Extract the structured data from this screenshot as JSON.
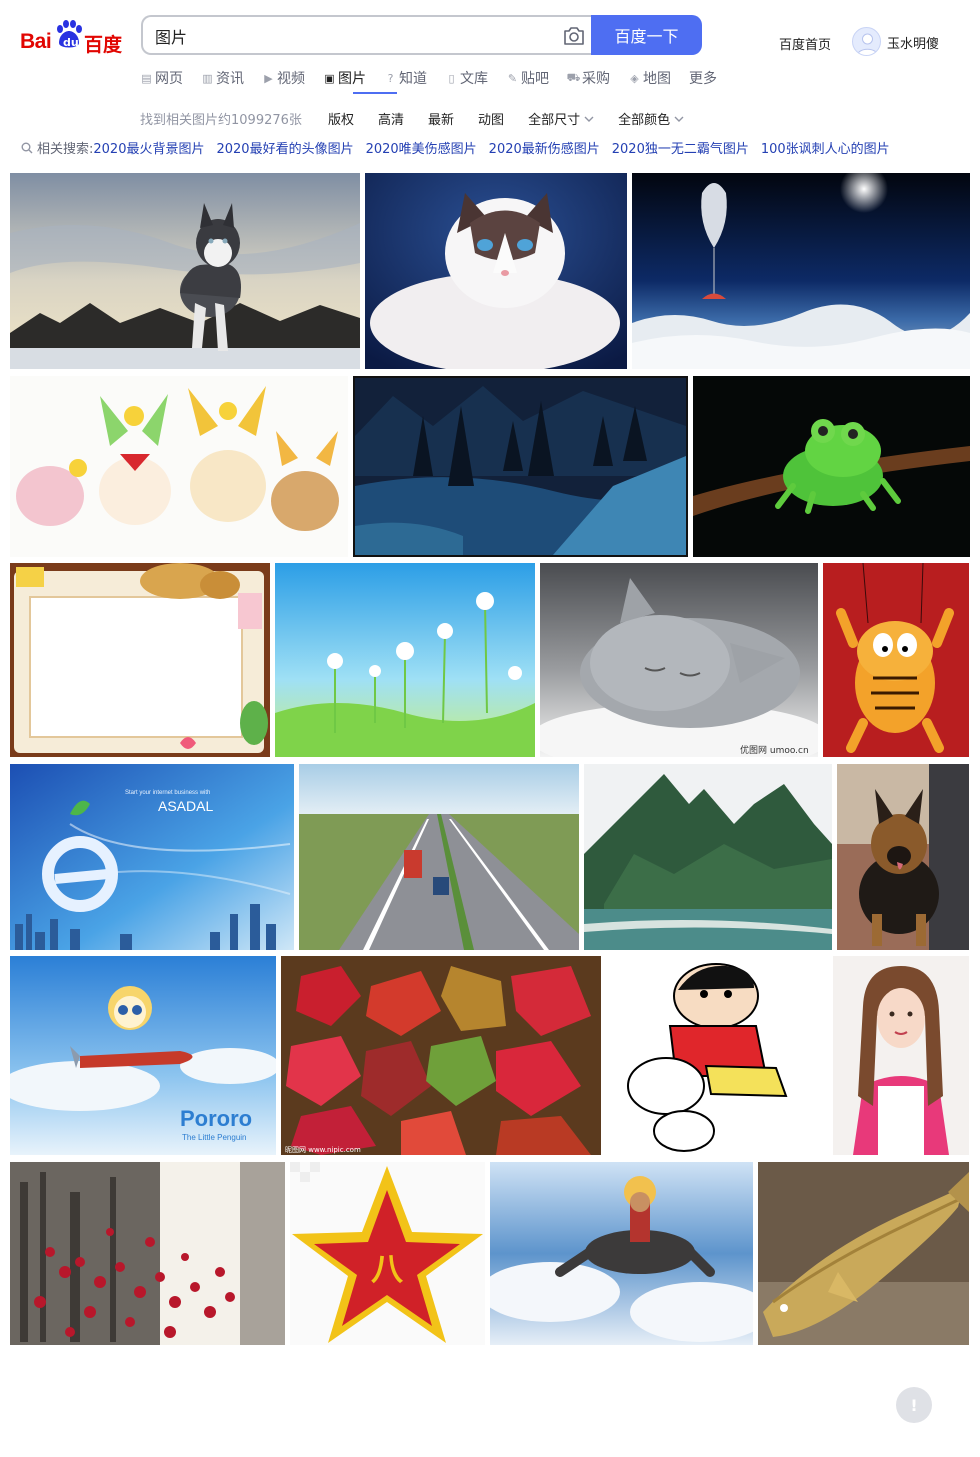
{
  "header": {
    "logo_latin": "Bai",
    "logo_du": "du",
    "logo_chinese": "百度",
    "search_value": "图片",
    "search_button": "百度一下",
    "home_link": "百度首页",
    "username": "玉水明傻"
  },
  "nav": {
    "items": [
      {
        "label": "网页",
        "icon": "web-icon"
      },
      {
        "label": "资讯",
        "icon": "news-icon"
      },
      {
        "label": "视频",
        "icon": "video-icon"
      },
      {
        "label": "图片",
        "icon": "image-icon",
        "active": true
      },
      {
        "label": "知道",
        "icon": "question-icon"
      },
      {
        "label": "文库",
        "icon": "doc-icon"
      },
      {
        "label": "贴吧",
        "icon": "tieba-icon"
      },
      {
        "label": "采购",
        "icon": "cart-icon"
      },
      {
        "label": "地图",
        "icon": "map-icon"
      },
      {
        "label": "更多",
        "icon": ""
      }
    ]
  },
  "filters": {
    "result_count": "找到相关图片约1099276张",
    "items": [
      "版权",
      "高清",
      "最新",
      "动图",
      "全部尺寸",
      "全部颜色"
    ]
  },
  "related": {
    "label": "相关搜索:",
    "links": [
      "2020最火背景图片",
      "2020最好看的头像图片",
      "2020唯美伤感图片",
      "2020最新伤感图片",
      "2020独一无二霸气图片",
      "100张讽刺人心的图片"
    ]
  },
  "images": {
    "asadal_text": "ASADAL",
    "asadal_tagline": "Start your internet business with",
    "pororo_title": "Pororo",
    "pororo_subtitle": "The Little Penguin",
    "kitten_watermark": "优图网 umoo.cn",
    "leaves_watermark": "昵图网 www.nipic.com",
    "star_char": "八"
  },
  "feedback": "!",
  "colors": {
    "accent": "#4e6ef2",
    "logo_red": "#e10602",
    "logo_blue": "#2932e1",
    "link": "#2440b3"
  }
}
